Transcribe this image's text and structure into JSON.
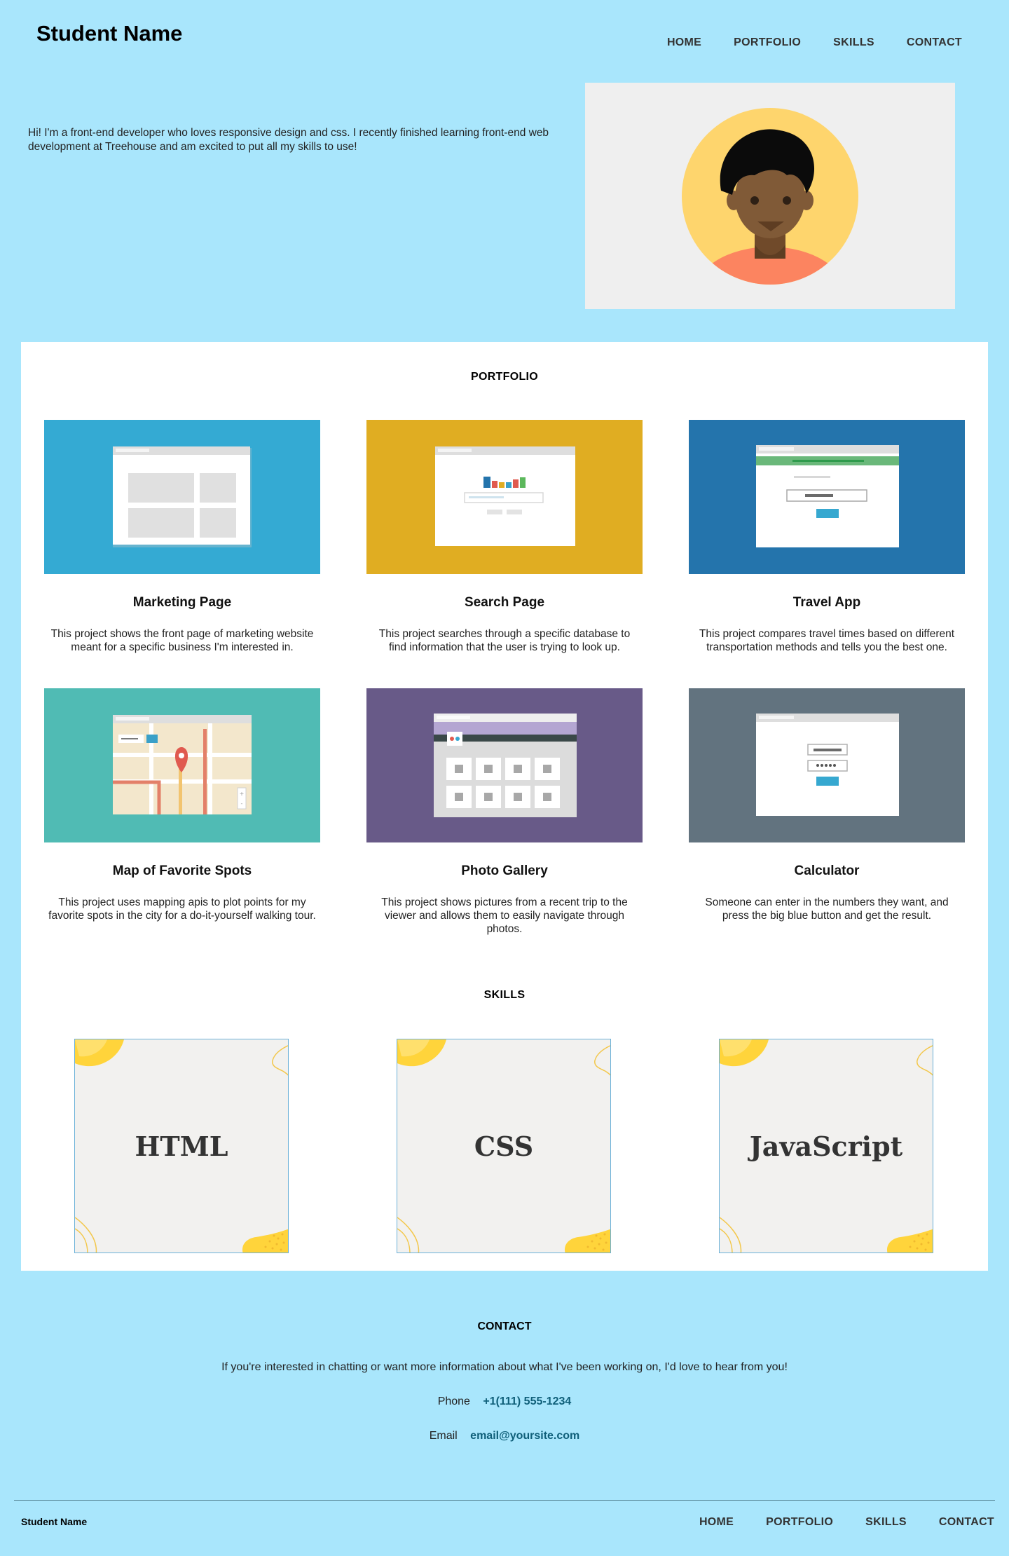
{
  "header": {
    "site_title": "Student Name",
    "nav": [
      "HOME",
      "PORTFOLIO",
      "SKILLS",
      "CONTACT"
    ]
  },
  "intro": {
    "text": "Hi! I'm a front-end developer who loves responsive design and css. I recently finished learning front-end web development at Treehouse and am excited to put all my skills to use!"
  },
  "portfolio": {
    "heading": "PORTFOLIO",
    "projects": [
      {
        "title": "Marketing Page",
        "description": "This project shows the front page of marketing website meant for a specific business I'm interested in.",
        "color": "#34aad3",
        "icon": "marketing-page-thumbnail"
      },
      {
        "title": "Search Page",
        "description": "This project searches through a specific database to find information that the user is trying to look up.",
        "color": "#e0ad22",
        "icon": "search-page-thumbnail"
      },
      {
        "title": "Travel App",
        "description": "This project compares travel times based on different transportation methods and tells you the best one.",
        "color": "#2474ac",
        "icon": "travel-app-thumbnail"
      },
      {
        "title": "Map of Favorite Spots",
        "description": "This project uses mapping apis to plot points for my favorite spots in the city for a do-it-yourself walking tour.",
        "color": "#50bbb4",
        "icon": "map-thumbnail"
      },
      {
        "title": "Photo Gallery",
        "description": "This project shows pictures from a recent trip to the viewer and allows them to easily navigate through photos.",
        "color": "#685a88",
        "icon": "photo-gallery-thumbnail"
      },
      {
        "title": "Calculator",
        "description": "Someone can enter in the numbers they want, and press the big blue button and get the result.",
        "color": "#62737f",
        "icon": "calculator-thumbnail"
      }
    ]
  },
  "skills": {
    "heading": "SKILLS",
    "items": [
      "HTML",
      "CSS",
      "JavaScript"
    ]
  },
  "contact": {
    "heading": "CONTACT",
    "text": "If you're interested in chatting or want more information about what I've been working on, I'd love to hear from you!",
    "phone_label": "Phone",
    "phone": "+1(111) 555-1234",
    "email_label": "Email",
    "email": "email@yoursite.com"
  },
  "footer": {
    "name": "Student Name",
    "nav": [
      "HOME",
      "PORTFOLIO",
      "SKILLS",
      "CONTACT"
    ]
  }
}
